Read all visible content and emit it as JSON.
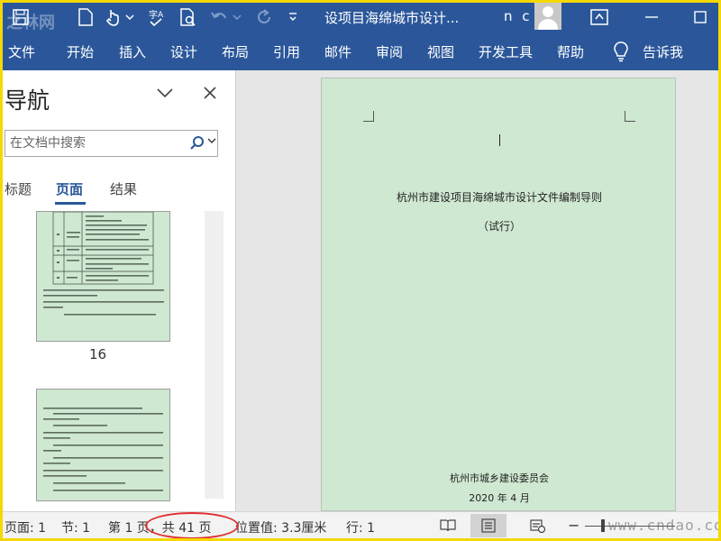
{
  "titlebar": {
    "title": "设项目海绵城市设计...",
    "user": "n c",
    "watermark": "之林网",
    "icons": [
      "save-icon",
      "touch-mode-icon",
      "spell-check-icon",
      "print-preview-icon",
      "undo-icon",
      "redo-icon",
      "customize-icon",
      "ribbon-display-icon"
    ]
  },
  "ribbon": {
    "tabs": [
      "文件",
      "开始",
      "插入",
      "设计",
      "布局",
      "引用",
      "邮件",
      "审阅",
      "视图",
      "开发工具",
      "帮助"
    ],
    "tell_me": "告诉我"
  },
  "nav": {
    "title": "导航",
    "search_placeholder": "在文档中搜索",
    "tabs": [
      "标题",
      "页面",
      "结果"
    ],
    "active_tab": "页面",
    "page_number": "16"
  },
  "document": {
    "title": "杭州市建设项目海绵城市设计文件编制导则",
    "subtitle": "（试行）",
    "org": "杭州市城乡建设委员会",
    "date": "2020 年 4 月"
  },
  "status": {
    "page": "页面: 1",
    "section": "节: 1",
    "page_of": "第 1 页，共 41 页",
    "position": "位置值: 3.3厘米",
    "line": "行: 1",
    "site_watermark": "www.cndao.com"
  },
  "colors": {
    "ribbon": "#2b579a",
    "page_bg": "#cfe8d1",
    "highlight_oval": "#e03030"
  }
}
